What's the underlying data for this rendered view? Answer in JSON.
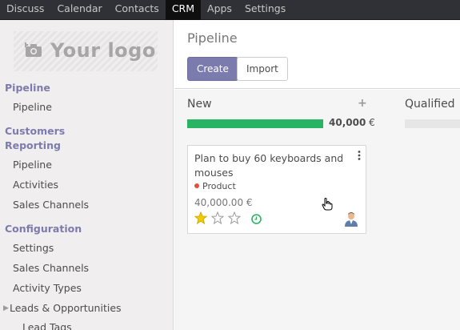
{
  "topbar": {
    "menu": [
      {
        "label": "Discuss",
        "active": false
      },
      {
        "label": "Calendar",
        "active": false
      },
      {
        "label": "Contacts",
        "active": false
      },
      {
        "label": "CRM",
        "active": true
      },
      {
        "label": "Apps",
        "active": false
      },
      {
        "label": "Settings",
        "active": false
      }
    ]
  },
  "sidebar": {
    "logo_text": "Your logo",
    "sections": {
      "pipeline": "Pipeline",
      "customers_reporting_line1": "Customers",
      "customers_reporting_line2": "Reporting",
      "configuration": "Configuration"
    },
    "items": {
      "pipeline": "Pipeline",
      "reporting_pipeline": "Pipeline",
      "activities": "Activities",
      "reporting_sales_channels": "Sales Channels",
      "settings": "Settings",
      "config_sales_channels": "Sales Channels",
      "activity_types": "Activity Types",
      "leads_opportunities": "Leads & Opportunities",
      "lead_tags": "Lead Tags"
    }
  },
  "main": {
    "title": "Pipeline",
    "create_label": "Create",
    "import_label": "Import",
    "columns": [
      {
        "title": "New",
        "total": "40,000",
        "currency": "€",
        "progress": 1.0
      },
      {
        "title": "Qualified",
        "progress": 0.0
      }
    ],
    "card": {
      "title": "Plan to buy 60 keyboards and mouses",
      "tag": "Product",
      "amount": "40,000.00 €",
      "rating": 1,
      "rating_max": 3
    }
  },
  "colors": {
    "brand": "#7c7bad",
    "progress": "#28b463",
    "tag_dot": "#e74c3c",
    "activity": "#28b463"
  }
}
